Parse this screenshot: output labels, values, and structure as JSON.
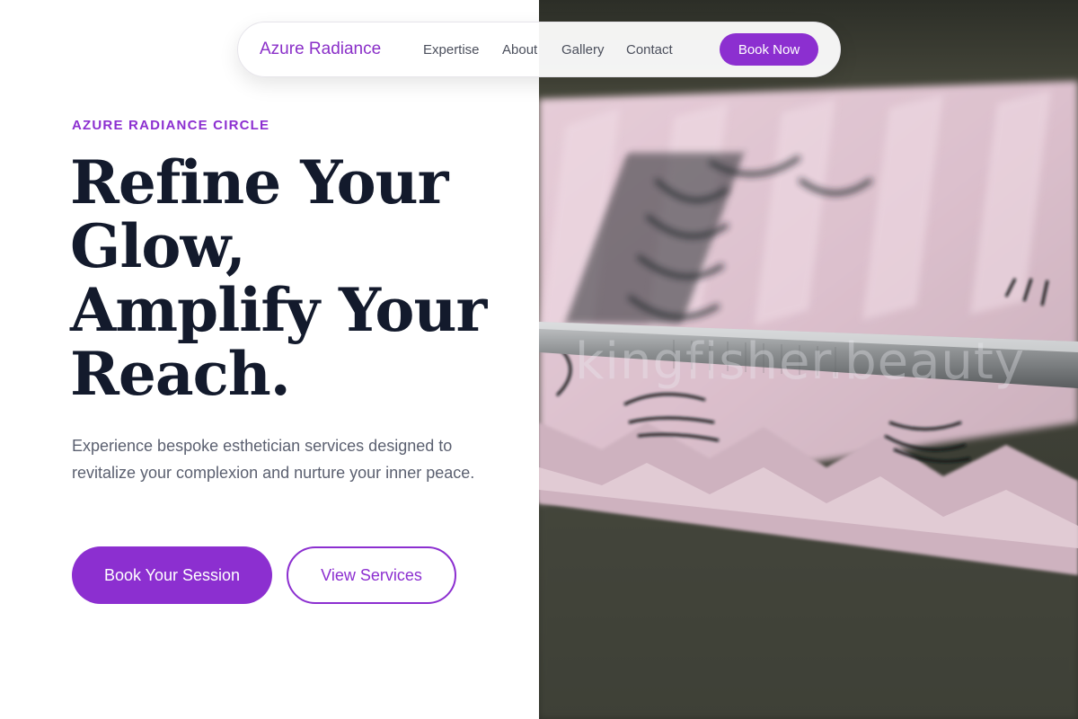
{
  "nav": {
    "brand": "Azure Radiance",
    "links": [
      "Expertise",
      "About",
      "Gallery",
      "Contact"
    ],
    "cta_label": "Book Now"
  },
  "hero": {
    "eyebrow": "AZURE RADIANCE CIRCLE",
    "headline_lines": [
      "Refine Your",
      "Glow,",
      "Amplify Your",
      "Reach."
    ],
    "subtext": "Experience bespoke esthetician services designed to revitalize your complexion and nurture your inner peace.",
    "primary_cta": "Book Your Session",
    "secondary_cta": "View Services"
  },
  "image": {
    "watermark": "kingfisher.beauty"
  },
  "colors": {
    "accent": "#8c2fd0",
    "heading": "#131a2c",
    "body_text": "#5b6070",
    "nav_text": "#4b4f5c"
  }
}
